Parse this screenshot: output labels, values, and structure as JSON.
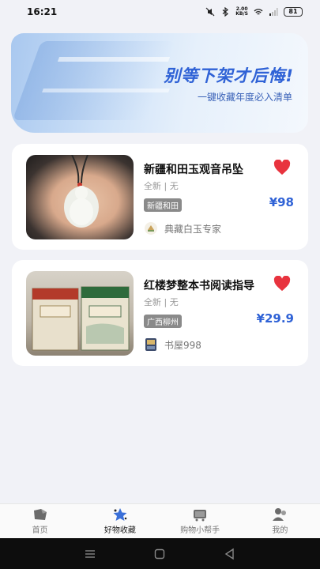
{
  "status_bar": {
    "time": "16:21",
    "speed_value": "2.00",
    "speed_unit": "KB/S",
    "battery": "81",
    "icons": [
      "mute-icon",
      "bluetooth-icon",
      "wifi-icon",
      "signal-icon",
      "battery-icon"
    ]
  },
  "banner": {
    "title": "别等下架才后悔!",
    "subtitle": "一键收藏年度必入清单"
  },
  "favorites": [
    {
      "title": "新疆和田玉观音吊坠",
      "condition": "全新 | 无",
      "tag": "新疆和田",
      "price": "¥98",
      "seller": "典藏白玉专家",
      "favorited": true
    },
    {
      "title": "红楼梦整本书阅读指导",
      "condition": "全新 | 无",
      "tag": "广西柳州",
      "price": "¥29.9",
      "seller": "书屋998",
      "favorited": true
    }
  ],
  "tabbar": {
    "items": [
      {
        "label": "首页",
        "icon": "home-icon"
      },
      {
        "label": "好物收藏",
        "icon": "collection-icon"
      },
      {
        "label": "购物小帮手",
        "icon": "cart-helper-icon"
      },
      {
        "label": "我的",
        "icon": "profile-icon"
      }
    ],
    "active": "好物收藏"
  },
  "colors": {
    "accent": "#2f62d6",
    "heart": "#e8333e",
    "tag_bg": "#8a8a8a",
    "background": "#f1f2f7"
  }
}
